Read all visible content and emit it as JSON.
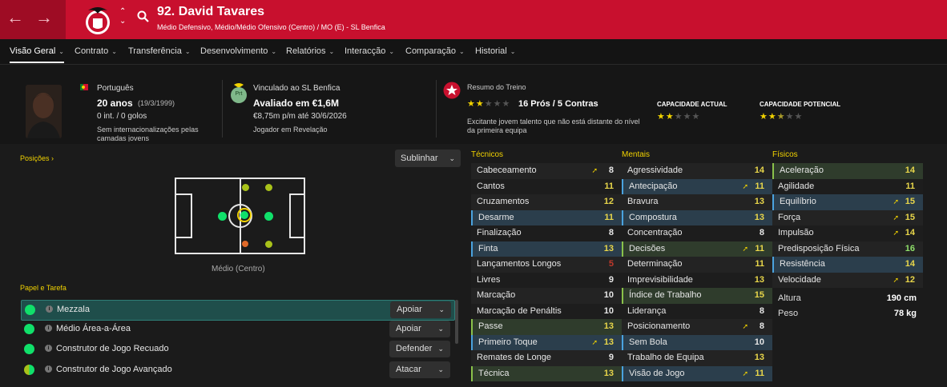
{
  "header": {
    "title": "92. David Tavares",
    "subtitle": "Médio Defensivo, Médio/Médio Ofensivo (Centro) / MO (E) - SL Benfica",
    "colors": {
      "primary": "#c8102e",
      "dark": "#9e0c24"
    }
  },
  "tabs": [
    {
      "label": "Visão Geral"
    },
    {
      "label": "Contrato"
    },
    {
      "label": "Transferência"
    },
    {
      "label": "Desenvolvimento"
    },
    {
      "label": "Relatórios"
    },
    {
      "label": "Interacção"
    },
    {
      "label": "Comparação"
    },
    {
      "label": "Historial"
    }
  ],
  "profile": {
    "nationality": "Português",
    "age": "20 anos",
    "dob": "(19/3/1999)",
    "caps": "0 int. / 0 golos",
    "youth": "Sem internacionalizações pelas camadas jovens"
  },
  "contract": {
    "club_label": "Vinculado ao SL Benfica",
    "value": "Avaliado em €1,6M",
    "wage": "€8,75m p/m até 30/6/2026",
    "status": "Jogador em Revelação",
    "badge": "Prt"
  },
  "training": {
    "title": "Resumo do Treino",
    "stars_rating": 2,
    "pros_cons": "16 Prós / 5 Contras",
    "desc": "Excitante jovem talento que não está distante do nível da primeira equipa",
    "ca_label": "CAPACIDADE ACTUAL",
    "ca_stars": 2,
    "pa_label": "CAPACIDADE POTENCIAL",
    "pa_stars": 2.5
  },
  "positions": {
    "title": "Posições",
    "highlight_btn": "Sublinhar",
    "caption": "Médio (Centro)"
  },
  "roles": {
    "title": "Papel e Tarefa",
    "items": [
      {
        "name": "Mezzala",
        "duty": "Apoiar"
      },
      {
        "name": "Médio Área-a-Área",
        "duty": "Apoiar"
      },
      {
        "name": "Construtor de Jogo Recuado",
        "duty": "Defender"
      },
      {
        "name": "Construtor de Jogo Avançado",
        "duty": "Atacar"
      }
    ]
  },
  "attributes": {
    "tecnicos": {
      "title": "Técnicos",
      "rows": [
        {
          "name": "Cabeceamento",
          "value": "8",
          "hl": "plain",
          "arrow": true
        },
        {
          "name": "Cantos",
          "value": "11",
          "hl": "alt",
          "arrow": false
        },
        {
          "name": "Cruzamentos",
          "value": "12",
          "hl": "plain",
          "arrow": false
        },
        {
          "name": "Desarme",
          "value": "11",
          "hl": "blue",
          "arrow": false
        },
        {
          "name": "Finalização",
          "value": "8",
          "hl": "alt",
          "arrow": false
        },
        {
          "name": "Finta",
          "value": "13",
          "hl": "blue",
          "arrow": false
        },
        {
          "name": "Lançamentos Longos",
          "value": "5",
          "hl": "plain",
          "arrow": false
        },
        {
          "name": "Livres",
          "value": "9",
          "hl": "alt",
          "arrow": false
        },
        {
          "name": "Marcação",
          "value": "10",
          "hl": "plain",
          "arrow": false
        },
        {
          "name": "Marcação de Penáltis",
          "value": "10",
          "hl": "alt",
          "arrow": false
        },
        {
          "name": "Passe",
          "value": "13",
          "hl": "green",
          "arrow": false
        },
        {
          "name": "Primeiro Toque",
          "value": "13",
          "hl": "blue",
          "arrow": true
        },
        {
          "name": "Remates de Longe",
          "value": "9",
          "hl": "plain",
          "arrow": false
        },
        {
          "name": "Técnica",
          "value": "13",
          "hl": "green",
          "arrow": false
        }
      ]
    },
    "mentais": {
      "title": "Mentais",
      "rows": [
        {
          "name": "Agressividade",
          "value": "14",
          "hl": "plain",
          "arrow": false
        },
        {
          "name": "Antecipação",
          "value": "11",
          "hl": "blue",
          "arrow": true
        },
        {
          "name": "Bravura",
          "value": "13",
          "hl": "plain",
          "arrow": false
        },
        {
          "name": "Compostura",
          "value": "13",
          "hl": "blue",
          "arrow": false
        },
        {
          "name": "Concentração",
          "value": "8",
          "hl": "alt",
          "arrow": false
        },
        {
          "name": "Decisões",
          "value": "11",
          "hl": "green",
          "arrow": true
        },
        {
          "name": "Determinação",
          "value": "11",
          "hl": "plain",
          "arrow": false
        },
        {
          "name": "Imprevisibilidade",
          "value": "13",
          "hl": "alt",
          "arrow": false
        },
        {
          "name": "Índice de Trabalho",
          "value": "15",
          "hl": "green",
          "arrow": false
        },
        {
          "name": "Liderança",
          "value": "8",
          "hl": "alt",
          "arrow": false
        },
        {
          "name": "Posicionamento",
          "value": "8",
          "hl": "plain",
          "arrow": true
        },
        {
          "name": "Sem Bola",
          "value": "10",
          "hl": "blue",
          "arrow": false
        },
        {
          "name": "Trabalho de Equipa",
          "value": "13",
          "hl": "plain",
          "arrow": false
        },
        {
          "name": "Visão de Jogo",
          "value": "11",
          "hl": "blue",
          "arrow": true
        }
      ]
    },
    "fisicos": {
      "title": "Físicos",
      "rows": [
        {
          "name": "Aceleração",
          "value": "14",
          "hl": "green",
          "arrow": false
        },
        {
          "name": "Agilidade",
          "value": "11",
          "hl": "alt",
          "arrow": false
        },
        {
          "name": "Equilíbrio",
          "value": "15",
          "hl": "blue",
          "arrow": true
        },
        {
          "name": "Força",
          "value": "15",
          "hl": "plain",
          "arrow": true
        },
        {
          "name": "Impulsão",
          "value": "14",
          "hl": "alt",
          "arrow": true
        },
        {
          "name": "Predisposição Física",
          "value": "16",
          "hl": "plain",
          "arrow": false
        },
        {
          "name": "Resistência",
          "value": "14",
          "hl": "blue",
          "arrow": false
        },
        {
          "name": "Velocidade",
          "value": "12",
          "hl": "plain",
          "arrow": true
        }
      ],
      "height_label": "Altura",
      "height": "190 cm",
      "weight_label": "Peso",
      "weight": "78 kg"
    }
  }
}
